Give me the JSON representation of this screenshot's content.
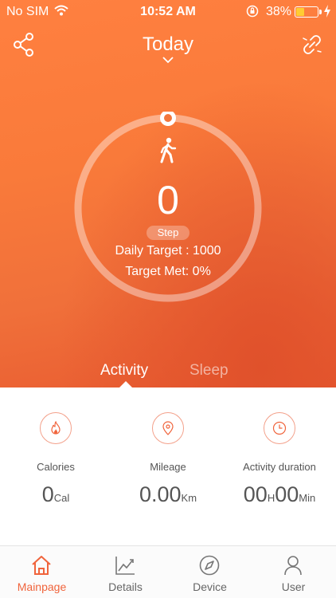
{
  "status_bar": {
    "carrier": "No SIM",
    "time": "10:52 AM",
    "battery_percent": "38%",
    "battery_level": 0.38,
    "battery_color": "#ffcc33"
  },
  "header": {
    "title": "Today",
    "share_icon": "share-icon",
    "link_icon": "unlink-icon"
  },
  "progress": {
    "steps_value": "0",
    "steps_label": "Step",
    "daily_target": "Daily Target : 1000",
    "target_met": "Target Met: 0%",
    "fraction": 0
  },
  "tabs": {
    "activity": "Activity",
    "sleep": "Sleep"
  },
  "stats": {
    "calories": {
      "label": "Calories",
      "value": "0",
      "unit": "Cal",
      "icon": "flame-icon"
    },
    "mileage": {
      "label": "Mileage",
      "value": "0.00",
      "unit": "Km",
      "icon": "location-pin-icon"
    },
    "duration": {
      "label": "Activity duration",
      "hours": "00",
      "hours_unit": "H",
      "minutes": "00",
      "minutes_unit": "Min",
      "icon": "clock-icon"
    }
  },
  "nav": {
    "items": [
      {
        "label": "Mainpage",
        "icon": "home-icon"
      },
      {
        "label": "Details",
        "icon": "chart-icon"
      },
      {
        "label": "Device",
        "icon": "compass-icon"
      },
      {
        "label": "User",
        "icon": "user-icon"
      }
    ]
  },
  "colors": {
    "accent": "#f0643c",
    "hero_top": "#ff8040",
    "hero_bottom": "#e0512b"
  }
}
